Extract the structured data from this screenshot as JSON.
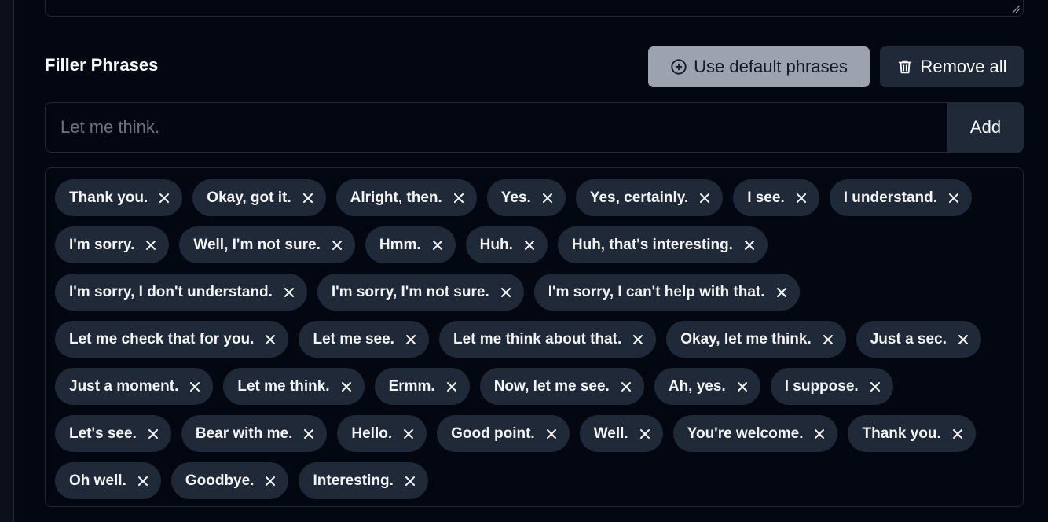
{
  "section": {
    "title": "Filler Phrases"
  },
  "buttons": {
    "use_default": "Use default phrases",
    "remove_all": "Remove all",
    "add": "Add"
  },
  "input": {
    "placeholder": "Let me think.",
    "value": ""
  },
  "colors": {
    "background": "#030712",
    "chip": "#1f2937",
    "default_button": "#9ca3af",
    "border": "#1f2937"
  },
  "phrases": [
    "Thank you.",
    "Okay, got it.",
    "Alright, then.",
    "Yes.",
    "Yes, certainly.",
    "I see.",
    "I understand.",
    "I'm sorry.",
    "Well, I'm not sure.",
    "Hmm.",
    "Huh.",
    "Huh, that's interesting.",
    "I'm sorry, I don't understand.",
    "I'm sorry, I'm not sure.",
    "I'm sorry, I can't help with that.",
    "Let me check that for you.",
    "Let me see.",
    "Let me think about that.",
    "Okay, let me think.",
    "Just a sec.",
    "Just a moment.",
    "Let me think.",
    "Ermm.",
    "Now, let me see.",
    "Ah, yes.",
    "I suppose.",
    "Let's see.",
    "Bear with me.",
    "Hello.",
    "Good point.",
    "Well.",
    "You're welcome.",
    "Thank you.",
    "Oh well.",
    "Goodbye.",
    "Interesting."
  ],
  "icons": {
    "use_default": "plus-circle-icon",
    "remove_all": "trash-icon",
    "chip_remove": "close-icon"
  }
}
